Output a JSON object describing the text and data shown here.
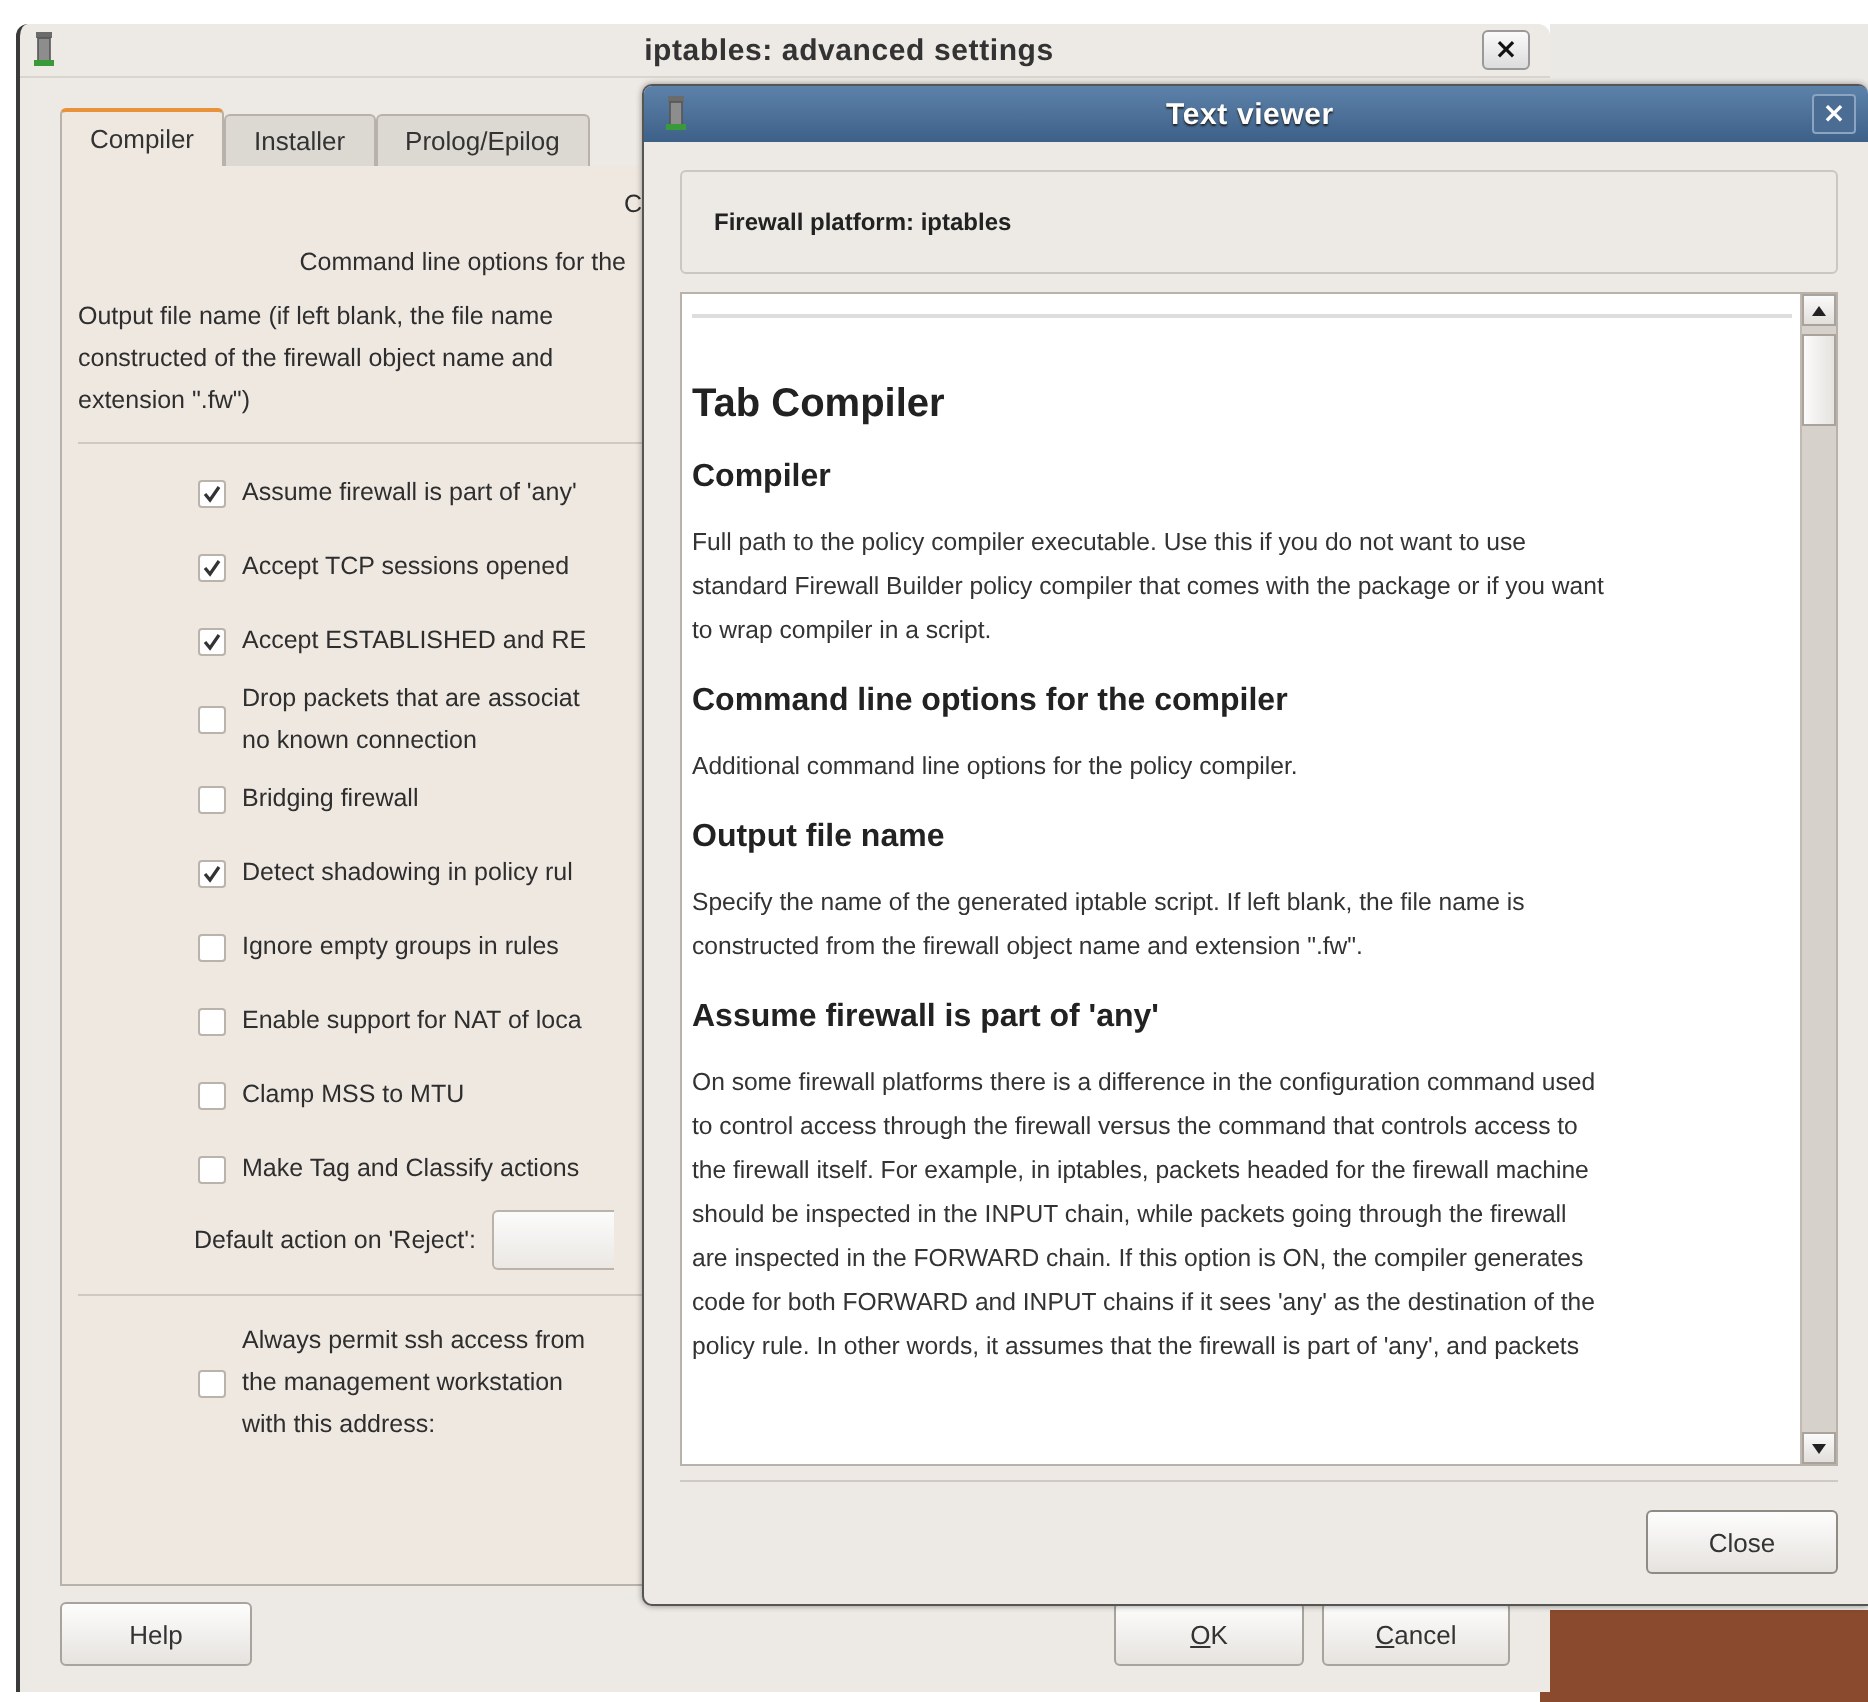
{
  "main_window": {
    "title": "iptables: advanced settings",
    "tabs": [
      {
        "label": "Compiler",
        "selected": true
      },
      {
        "label": "Installer",
        "selected": false
      },
      {
        "label": "Prolog/Epilog",
        "selected": false
      }
    ],
    "compiler_label": "C",
    "options_label": "Command line options for the",
    "close_icon": "×",
    "output_label": [
      "Output file name (if left blank, the file name",
      "constructed of the firewall object name and",
      "extension \".fw\")"
    ],
    "checkboxes": [
      {
        "lines": [
          "Assume firewall is part of 'any'"
        ],
        "checked": true
      },
      {
        "lines": [
          "Accept TCP sessions opened"
        ],
        "checked": true
      },
      {
        "lines": [
          "Accept ESTABLISHED and RE"
        ],
        "checked": true
      },
      {
        "lines": [
          "Drop packets that are associat",
          "no known connection"
        ],
        "checked": false
      },
      {
        "lines": [
          "Bridging firewall"
        ],
        "checked": false
      },
      {
        "lines": [
          "Detect shadowing in policy rul"
        ],
        "checked": true
      },
      {
        "lines": [
          "Ignore empty groups in rules"
        ],
        "checked": false
      },
      {
        "lines": [
          "Enable support for NAT of loca"
        ],
        "checked": false
      },
      {
        "lines": [
          "Clamp MSS to MTU"
        ],
        "checked": false
      },
      {
        "lines": [
          "Make Tag and Classify actions"
        ],
        "checked": false
      }
    ],
    "reject_label": "Default action on 'Reject':",
    "ssh_option": {
      "lines": [
        "Always permit ssh access from",
        "the management workstation",
        "with this address:"
      ],
      "checked": false
    },
    "help_button": "Help",
    "ok_button": "OK",
    "cancel_button": "Cancel"
  },
  "text_viewer": {
    "title": "Text viewer",
    "close_icon": "×",
    "platform": "Firewall platform: iptables",
    "content": [
      {
        "kind": "h1",
        "lines": [
          "Tab Compiler"
        ]
      },
      {
        "kind": "h3",
        "lines": [
          "Compiler"
        ]
      },
      {
        "kind": "p",
        "lines": [
          "Full path to the policy compiler executable. Use this if you do not want to use",
          "standard Firewall Builder policy compiler that comes with the package or if you want",
          "to wrap compiler in a script."
        ]
      },
      {
        "kind": "h3",
        "lines": [
          "Command line options for the compiler"
        ]
      },
      {
        "kind": "p",
        "lines": [
          "Additional command line options for the policy compiler."
        ]
      },
      {
        "kind": "h3",
        "lines": [
          "Output file name"
        ]
      },
      {
        "kind": "p",
        "lines": [
          "Specify the name of the generated iptable script. If left blank, the file name is",
          "constructed from the firewall object name and extension \".fw\"."
        ]
      },
      {
        "kind": "h3",
        "lines": [
          "Assume firewall is part of 'any'"
        ]
      },
      {
        "kind": "p",
        "lines": [
          "On some firewall platforms there is a difference in the configuration command used",
          "to control access through the firewall versus the command that controls access to",
          "the firewall itself. For example, in iptables, packets headed for the firewall machine",
          "should be inspected in the INPUT chain, while packets going through the firewall",
          "are inspected in the FORWARD chain. If this option is ON, the compiler generates",
          "code for both FORWARD and INPUT chains if it sees 'any' as the destination of the",
          "policy rule. In other words, it assumes that the firewall is part of 'any', and packets"
        ]
      }
    ],
    "close_button": "Close"
  }
}
